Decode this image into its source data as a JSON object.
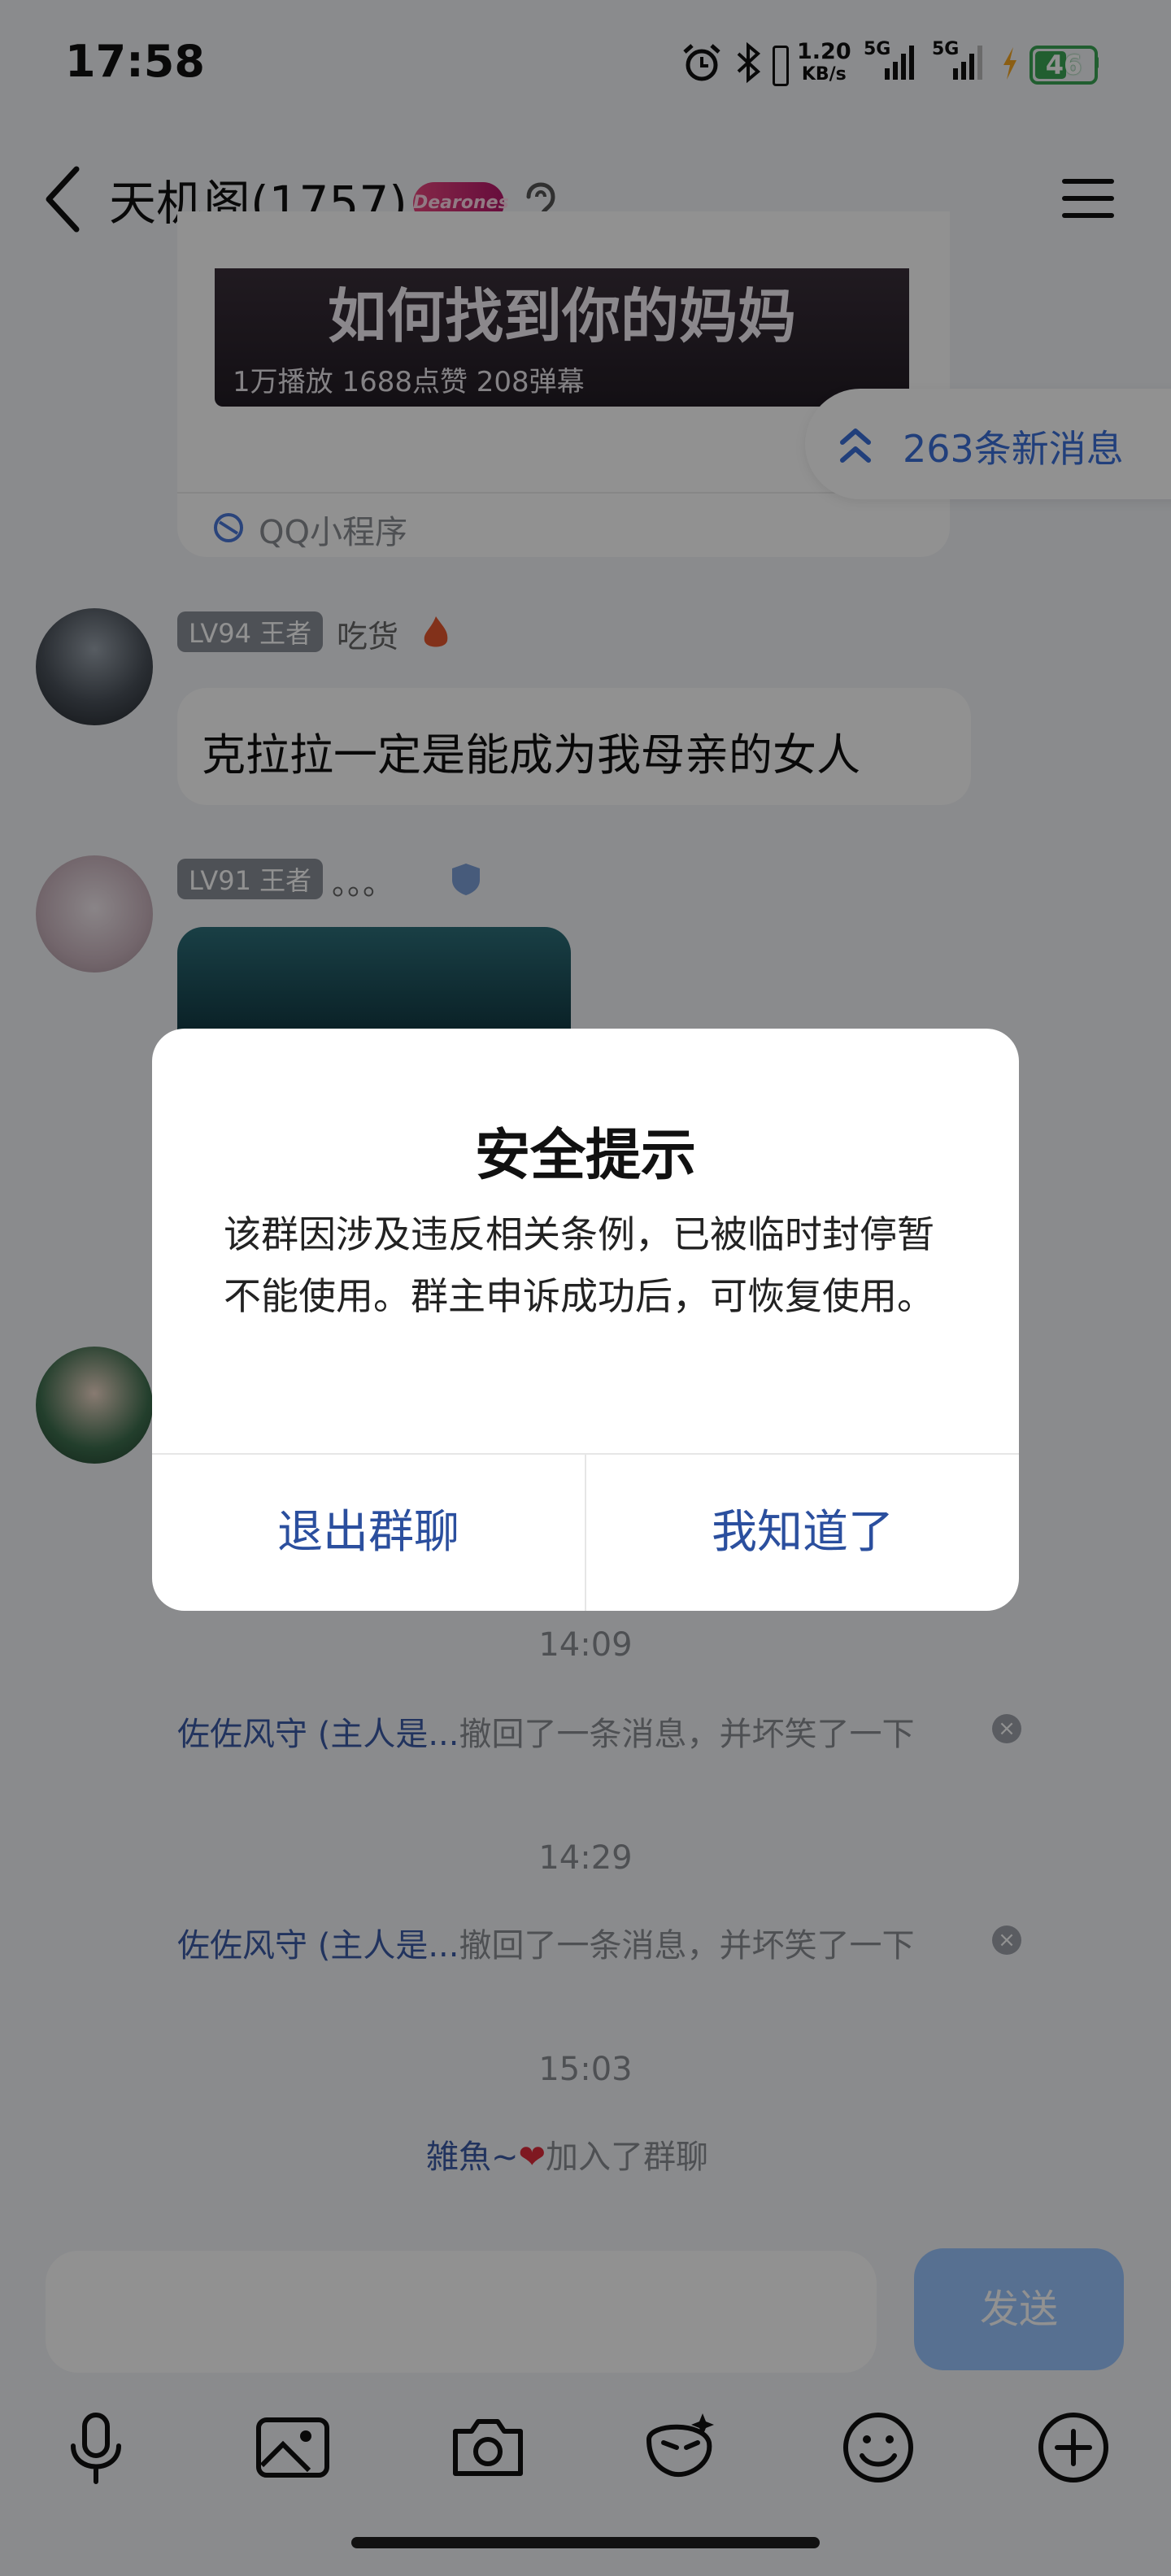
{
  "status_bar": {
    "time": "17:58",
    "net_speed_value": "1.20",
    "net_speed_unit": "KB/s",
    "sim1": "5G",
    "sim2": "5G",
    "battery": "46"
  },
  "header": {
    "title": "天机阁(1757)",
    "badge_text": "Dearones"
  },
  "new_messages": {
    "label": "263条新消息"
  },
  "mini_program_card": {
    "video_title": "如何找到你的妈妈",
    "stats": "1万播放  1688点赞  208弹幕",
    "source": "QQ小程序"
  },
  "messages": [
    {
      "level": "LV94 王者",
      "nickname": "吃货",
      "text": "克拉拉一定是能成为我母亲的女人"
    },
    {
      "level": "LV91 王者",
      "nickname": "。。。"
    }
  ],
  "events": [
    {
      "time": "14:09",
      "who": "佐佐风守 (主人是...",
      "action": "撤回了一条消息，并坏笑了一下"
    },
    {
      "time": "14:29",
      "who": "佐佐风守 (主人是...",
      "action": "撤回了一条消息，并坏笑了一下"
    },
    {
      "time": "15:03",
      "who": "雑魚~",
      "action": "加入了群聊"
    }
  ],
  "dialog": {
    "title": "安全提示",
    "body": "该群因涉及违反相关条例，已被临时封停暂不能使用。群主申诉成功后，可恢复使用。",
    "exit_label": "退出群聊",
    "ok_label": "我知道了"
  },
  "composer": {
    "send_label": "发送"
  },
  "toolbar": {
    "icons": [
      "microphone-icon",
      "image-icon",
      "camera-icon",
      "sticker-icon",
      "emoji-icon",
      "plus-icon"
    ]
  },
  "colors": {
    "accent": "#2b4f9e",
    "send_button": "#99c6ff",
    "level_badge": "#8a8f98"
  }
}
